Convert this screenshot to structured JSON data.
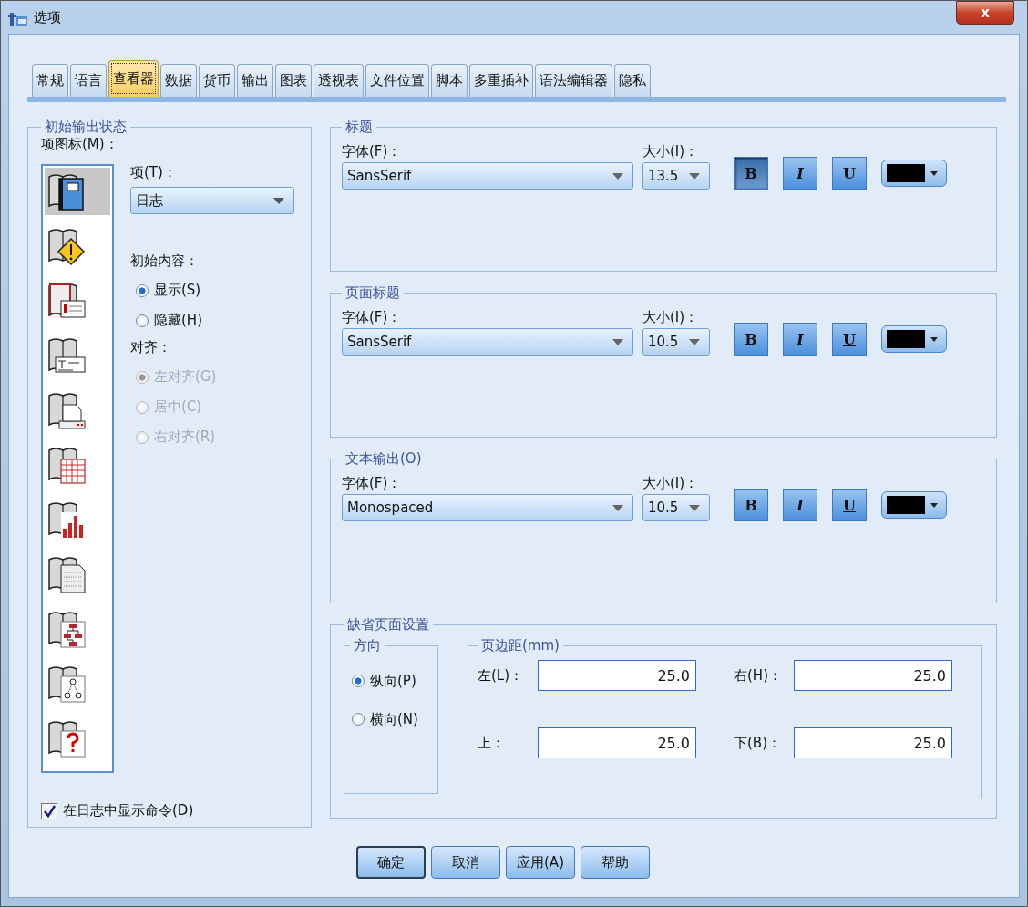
{
  "window": {
    "title": "选项",
    "close_label": "x"
  },
  "tabs": [
    {
      "label": "常规",
      "selected": false
    },
    {
      "label": "语言",
      "selected": false
    },
    {
      "label": "查看器",
      "selected": true
    },
    {
      "label": "数据",
      "selected": false
    },
    {
      "label": "货币",
      "selected": false
    },
    {
      "label": "输出",
      "selected": false
    },
    {
      "label": "图表",
      "selected": false
    },
    {
      "label": "透视表",
      "selected": false
    },
    {
      "label": "文件位置",
      "selected": false
    },
    {
      "label": "脚本",
      "selected": false
    },
    {
      "label": "多重插补",
      "selected": false
    },
    {
      "label": "语法编辑器",
      "selected": false
    },
    {
      "label": "隐私",
      "selected": false
    }
  ],
  "initial_output": {
    "title": "初始输出状态",
    "icons_label": "项图标(M)：",
    "icons": [
      {
        "kind": "log",
        "selected": true
      },
      {
        "kind": "warning",
        "selected": false
      },
      {
        "kind": "notes",
        "selected": false
      },
      {
        "kind": "title",
        "selected": false
      },
      {
        "kind": "page",
        "selected": false
      },
      {
        "kind": "table",
        "selected": false
      },
      {
        "kind": "chart",
        "selected": false
      },
      {
        "kind": "text",
        "selected": false
      },
      {
        "kind": "tree",
        "selected": false
      },
      {
        "kind": "model",
        "selected": false
      },
      {
        "kind": "unknown",
        "selected": false
      }
    ],
    "item_label": "项(T)：",
    "item_value": "日志",
    "content_label": "初始内容：",
    "content_options": [
      {
        "label": "显示(S)",
        "selected": true
      },
      {
        "label": "隐藏(H)",
        "selected": false
      }
    ],
    "align_label": "对齐：",
    "align_options": [
      {
        "label": "左对齐(G)",
        "selected": true,
        "disabled": true
      },
      {
        "label": "居中(C)",
        "selected": false,
        "disabled": true
      },
      {
        "label": "右对齐(R)",
        "selected": false,
        "disabled": true
      }
    ],
    "show_commands": {
      "label": "在日志中显示命令(D)",
      "checked": true
    }
  },
  "font_groups": [
    {
      "title": "标题",
      "font_label": "字体(F)：",
      "font": "SansSerif",
      "size_label": "大小(I)：",
      "size": "13.5",
      "bold": true,
      "italic": false,
      "underline": false,
      "bold_label": "B",
      "italic_label": "I",
      "underline_label": "U"
    },
    {
      "title": "页面标题",
      "font_label": "字体(F)：",
      "font": "SansSerif",
      "size_label": "大小(I)：",
      "size": "10.5",
      "bold": false,
      "italic": false,
      "underline": false,
      "bold_label": "B",
      "italic_label": "I",
      "underline_label": "U"
    },
    {
      "title": "文本输出(O)",
      "font_label": "字体(F)：",
      "font": "Monospaced",
      "size_label": "大小(I)：",
      "size": "10.5",
      "bold": false,
      "italic": false,
      "underline": false,
      "bold_label": "B",
      "italic_label": "I",
      "underline_label": "U"
    }
  ],
  "page_setup": {
    "title": "缺省页面设置",
    "orientation": {
      "title": "方向",
      "options": [
        {
          "label": "纵向(P)",
          "selected": true
        },
        {
          "label": "横向(N)",
          "selected": false
        }
      ]
    },
    "margins": {
      "title": "页边距(mm)",
      "fields": [
        {
          "label": "左(L)：",
          "value": "25.0"
        },
        {
          "label": "右(H)：",
          "value": "25.0"
        },
        {
          "label": "上：",
          "value": "25.0"
        },
        {
          "label": "下(B)：",
          "value": "25.0"
        }
      ]
    }
  },
  "buttons": [
    {
      "label": "确定",
      "default": true
    },
    {
      "label": "取消",
      "default": false
    },
    {
      "label": "应用(A)",
      "default": false
    },
    {
      "label": "帮助",
      "default": false
    }
  ]
}
